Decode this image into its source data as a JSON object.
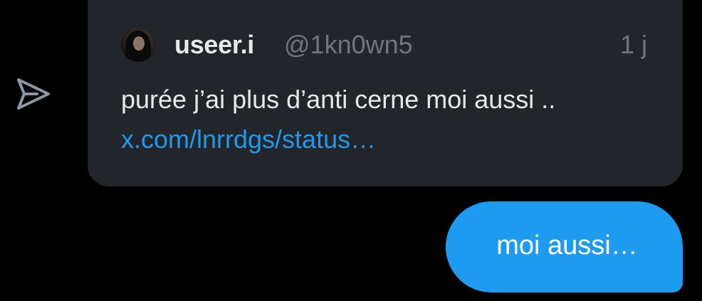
{
  "quoted_tweet": {
    "author_name": "useer.i",
    "author_handle": "@1kn0wn5",
    "timestamp": "1 j",
    "text": "purée j’ai plus d’anti cerne moi aussi ..",
    "link": "x.com/lnrrdgs/status…"
  },
  "message": {
    "text": "moi aussi…"
  },
  "icons": {
    "share": "share-arrow-icon",
    "avatar": "avatar"
  },
  "colors": {
    "background": "#000000",
    "card": "#222529",
    "bubble": "#1d9bf0",
    "link": "#1d9bf0",
    "primary_text": "#e7e9ea",
    "secondary_text": "#71767b"
  }
}
